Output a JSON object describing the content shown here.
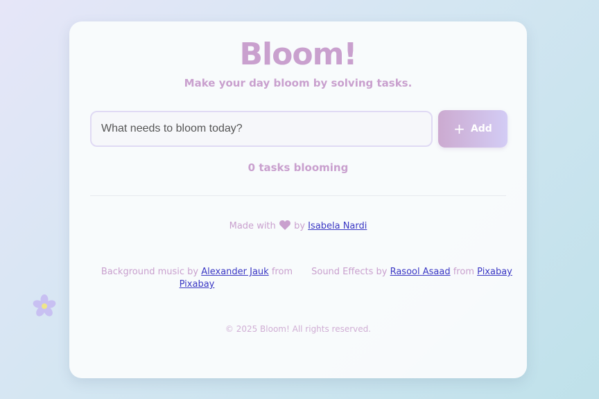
{
  "app": {
    "title": "Bloom!",
    "subtitle": "Make your day bloom by solving tasks."
  },
  "task_form": {
    "input_placeholder": "What needs to bloom today?",
    "input_value": "",
    "add_label": "Add",
    "add_icon": "plus-icon"
  },
  "task_count": "0 tasks blooming",
  "footer": {
    "made_with_prefix": "Made with",
    "made_with_icon": "heart-icon",
    "made_with_by": "by",
    "author": "Isabela Nardi",
    "music_prefix": "Background music by",
    "music_author": "Alexander Jauk",
    "music_from": "from",
    "music_source": "Pixabay",
    "sfx_prefix": "Sound Effects by",
    "sfx_author": "Rasool Asaad",
    "sfx_from": "from",
    "sfx_source": "Pixabay",
    "copyright": "© 2025 Bloom! All rights reserved."
  },
  "decorations": {
    "flower_icon": "flower-icon"
  },
  "colors": {
    "accent_pink": "#c9a0ce",
    "link": "#3a37c4",
    "flower_petal": "#c8bff2",
    "flower_center": "#eee68a"
  }
}
